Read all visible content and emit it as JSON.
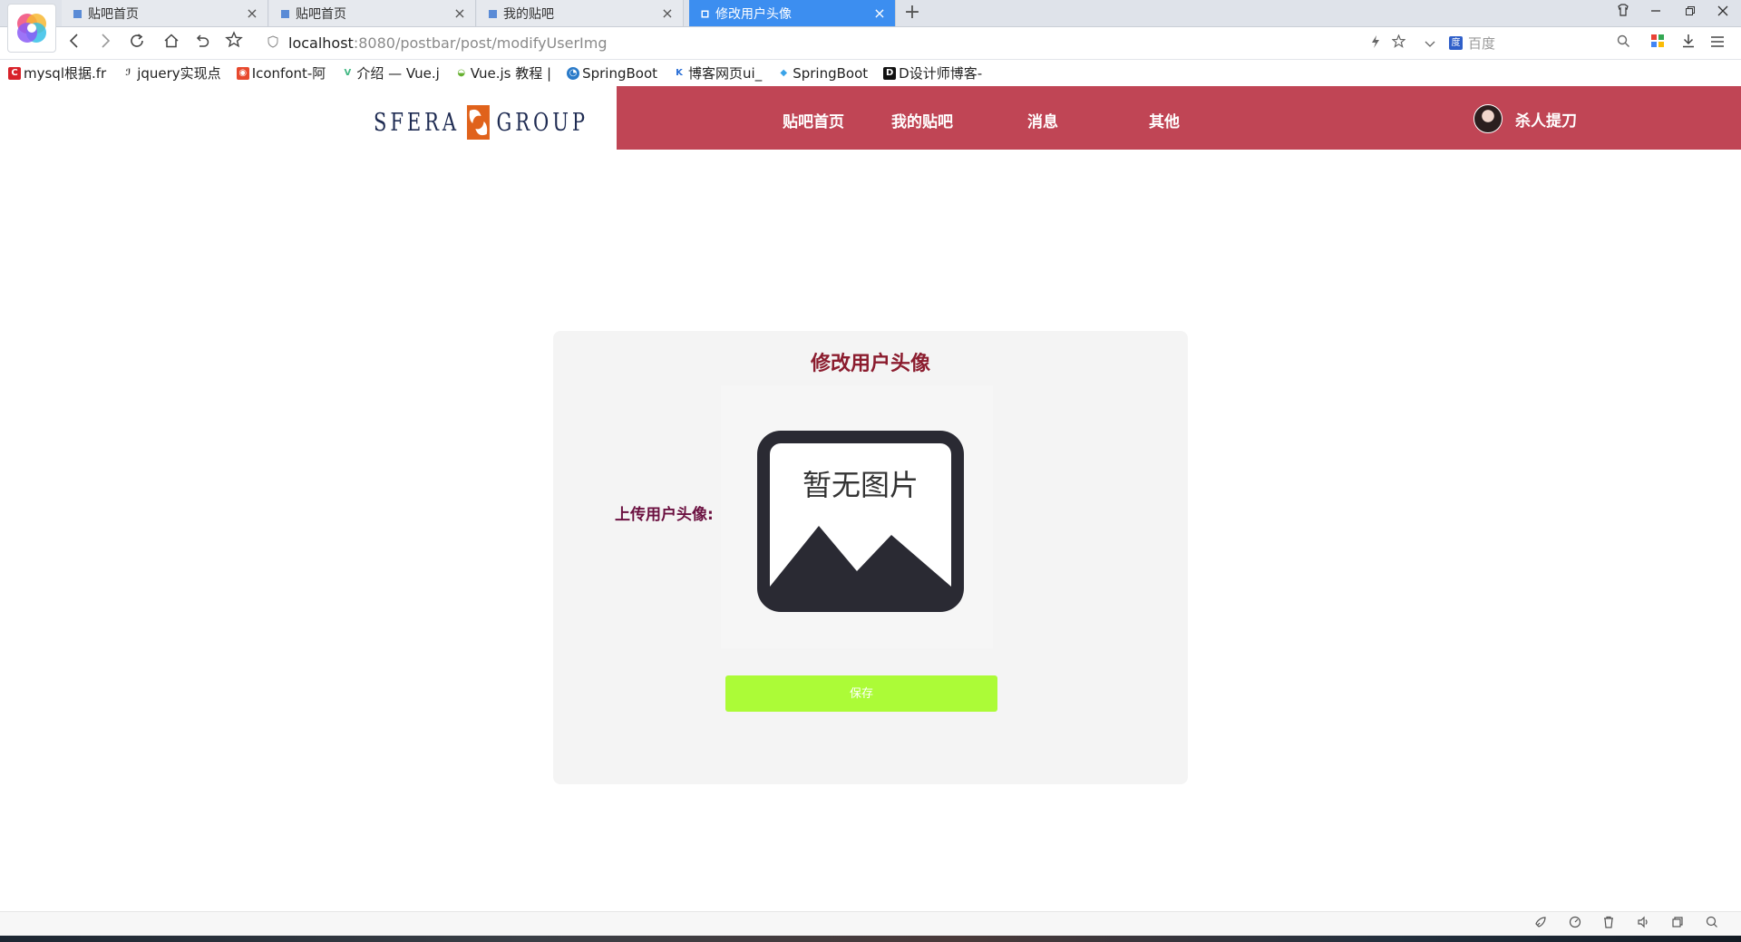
{
  "browser": {
    "tabs": [
      {
        "title": "贴吧首页",
        "active": false
      },
      {
        "title": "贴吧首页",
        "active": false
      },
      {
        "title": "我的贴吧",
        "active": false
      },
      {
        "title": "修改用户头像",
        "active": true
      }
    ],
    "tab_close_glyph": "×",
    "new_tab_glyph": "+",
    "address": {
      "host": "localhost",
      "path": ":8080/postbar/post/modifyUserImg"
    },
    "search_placeholder": "百度",
    "bookmarks": [
      {
        "label": "mysql根据.fr",
        "icon": "c-brand-icon",
        "color": "#d8222a",
        "glyph": "C"
      },
      {
        "label": "jquery实现点",
        "icon": "jquery-icon",
        "color": "#ffffff",
        "glyph": "ℐ"
      },
      {
        "label": "Iconfont-阿",
        "icon": "iconfont-icon",
        "color": "#e7492e",
        "glyph": "◉"
      },
      {
        "label": "介绍 — Vue.j",
        "icon": "vue-icon",
        "color": "#41b883",
        "glyph": "V"
      },
      {
        "label": "Vue.js 教程 |",
        "icon": "runoob-icon",
        "color": "#66b030",
        "glyph": "◒"
      },
      {
        "label": "SpringBoot",
        "icon": "springboot-icon",
        "color": "#2b7bc9",
        "glyph": "◔"
      },
      {
        "label": "博客网页ui_",
        "icon": "k-icon",
        "color": "#2a6fd6",
        "glyph": "K"
      },
      {
        "label": "SpringBoot",
        "icon": "shield-icon",
        "color": "#3aa3e8",
        "glyph": "◆"
      },
      {
        "label": "D设计师博客-",
        "icon": "d-icon",
        "color": "#111111",
        "glyph": "D"
      }
    ]
  },
  "site": {
    "logo_left": "SFERA",
    "logo_right": "GROUP",
    "menu": [
      "贴吧首页",
      "我的贴吧",
      "消息",
      "其他"
    ],
    "username": "杀人提刀",
    "header_color": "#c04555"
  },
  "card": {
    "title": "修改用户头像",
    "upload_label": "上传用户头像:",
    "placeholder_text": "暂无图片",
    "save_label": "保存",
    "save_color": "#acfb37"
  }
}
